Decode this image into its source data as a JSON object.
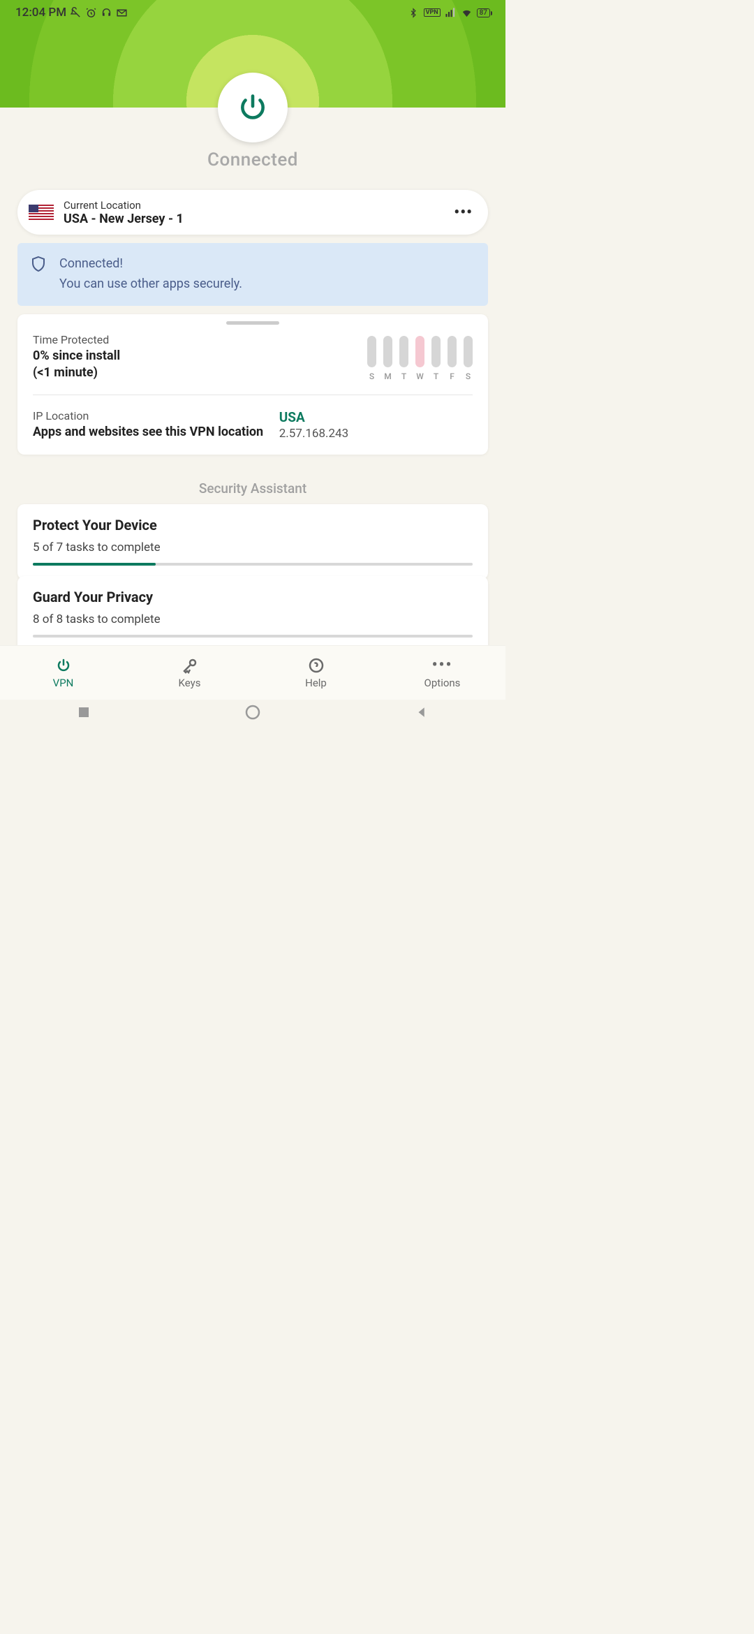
{
  "status_bar": {
    "time": "12:04 PM",
    "battery": "87"
  },
  "connection": {
    "status_label": "Connected"
  },
  "location": {
    "label": "Current Location",
    "value": "USA - New Jersey - 1"
  },
  "alert": {
    "title": "Connected!",
    "body": "You can use other apps securely."
  },
  "stats": {
    "time_protected_label": "Time Protected",
    "time_protected_value1": "0% since install",
    "time_protected_value2": "(<1 minute)",
    "days": [
      "S",
      "M",
      "T",
      "W",
      "T",
      "F",
      "S"
    ],
    "ip_location_label": "IP Location",
    "ip_location_desc": "Apps and websites see this VPN location",
    "ip_country": "USA",
    "ip_address": "2.57.168.243"
  },
  "security_assistant": {
    "header": "Security Assistant",
    "tasks": [
      {
        "title": "Protect Your Device",
        "sub": "5 of 7 tasks to complete",
        "progress": 28
      },
      {
        "title": "Guard Your Privacy",
        "sub": "8 of 8 tasks to complete",
        "progress": 0
      }
    ]
  },
  "nav": {
    "vpn": "VPN",
    "keys": "Keys",
    "help": "Help",
    "options": "Options"
  }
}
